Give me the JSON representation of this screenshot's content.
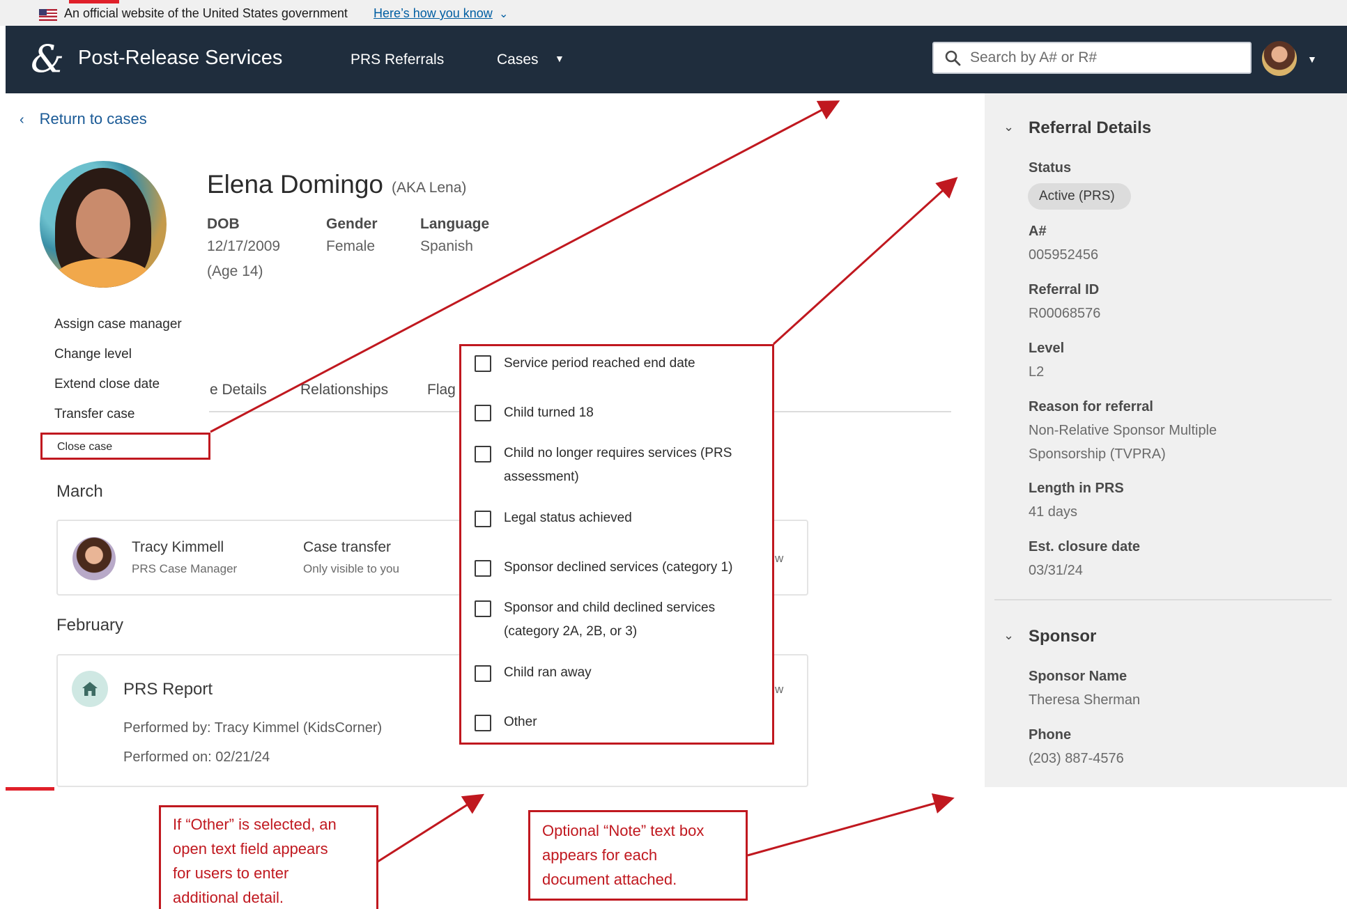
{
  "gov_banner": {
    "text": "An official website of the United States government",
    "link": "Here’s how you know"
  },
  "header": {
    "logo_glyph": "&",
    "title": "Post-Release Services",
    "nav": [
      {
        "label": "PRS Referrals"
      },
      {
        "label": "Cases"
      }
    ],
    "search": {
      "placeholder": "Search by A# or R#",
      "value": ""
    }
  },
  "back_link": {
    "label": "Return to cases"
  },
  "profile": {
    "name": "Elena Domingo",
    "aka": "(AKA Lena)",
    "dob": {
      "label": "DOB",
      "value": "12/17/2009",
      "age": "(Age 14)"
    },
    "gender": {
      "label": "Gender",
      "value": "Female"
    },
    "language": {
      "label": "Language",
      "value": "Spanish"
    }
  },
  "actions_menu": {
    "items": [
      {
        "label": "Assign case manager"
      },
      {
        "label": "Change level"
      },
      {
        "label": "Extend close date"
      },
      {
        "label": "Transfer case"
      },
      {
        "label": "Close case"
      }
    ]
  },
  "tabs": [
    {
      "label": "e Details"
    },
    {
      "label": "Relationships"
    },
    {
      "label": "Flag"
    }
  ],
  "activity": {
    "groups": [
      {
        "month": "March",
        "person": "Tracy Kimmell",
        "role": "PRS Case Manager",
        "event": "Case transfer",
        "visibility": "Only visible to you",
        "partial": "w"
      },
      {
        "month": "February",
        "title": "PRS Report",
        "performed_by": "Performed by: Tracy Kimmel (KidsCorner)",
        "performed_on": "Performed on: 02/21/24",
        "partial": "w"
      }
    ]
  },
  "close_reasons": [
    {
      "label": "Service period reached end date",
      "checked": false
    },
    {
      "label": "Child turned 18",
      "checked": false
    },
    {
      "label": "Child no longer requires services (PRS",
      "label2": "assessment)",
      "checked": false
    },
    {
      "label": "Legal status achieved",
      "checked": false
    },
    {
      "label": "Sponsor declined services (category 1)",
      "checked": false
    },
    {
      "label": "Sponsor and child declined services",
      "label2": "(category 2A, 2B, or 3)",
      "checked": false
    },
    {
      "label": "Child ran away",
      "checked": false
    },
    {
      "label": "Other",
      "checked": false
    }
  ],
  "sidebar": {
    "referral": {
      "title": "Referral Details",
      "status_label": "Status",
      "status_value": "Active (PRS)",
      "a_number_label": "A#",
      "a_number_value": "005952456",
      "referral_id_label": "Referral ID",
      "referral_id_value": "R00068576",
      "level_label": "Level",
      "level_value": "L2",
      "reason_label": "Reason for referral",
      "reason_value_line1": "Non-Relative Sponsor Multiple",
      "reason_value_line2": "Sponsorship (TVPRA)",
      "length_label": "Length in PRS",
      "length_value": "41 days",
      "closure_label": "Est. closure date",
      "closure_value": "03/31/24"
    },
    "sponsor": {
      "title": "Sponsor",
      "name_label": "Sponsor Name",
      "name_value": "Theresa Sherman",
      "phone_label": "Phone",
      "phone_value": "(203) 887-4576"
    }
  },
  "annotations": {
    "other_note": [
      "If “Other” is selected, an",
      "open text field appears",
      "for users to enter",
      "additional detail."
    ],
    "note_box": [
      "Optional “Note” text box",
      "appears for each",
      "document attached."
    ]
  },
  "colors": {
    "header_bg": "#1f2d3d",
    "annotation_red": "#c0181f",
    "link_blue": "#1a5a96",
    "sidebar_bg": "#f0f0f0"
  }
}
